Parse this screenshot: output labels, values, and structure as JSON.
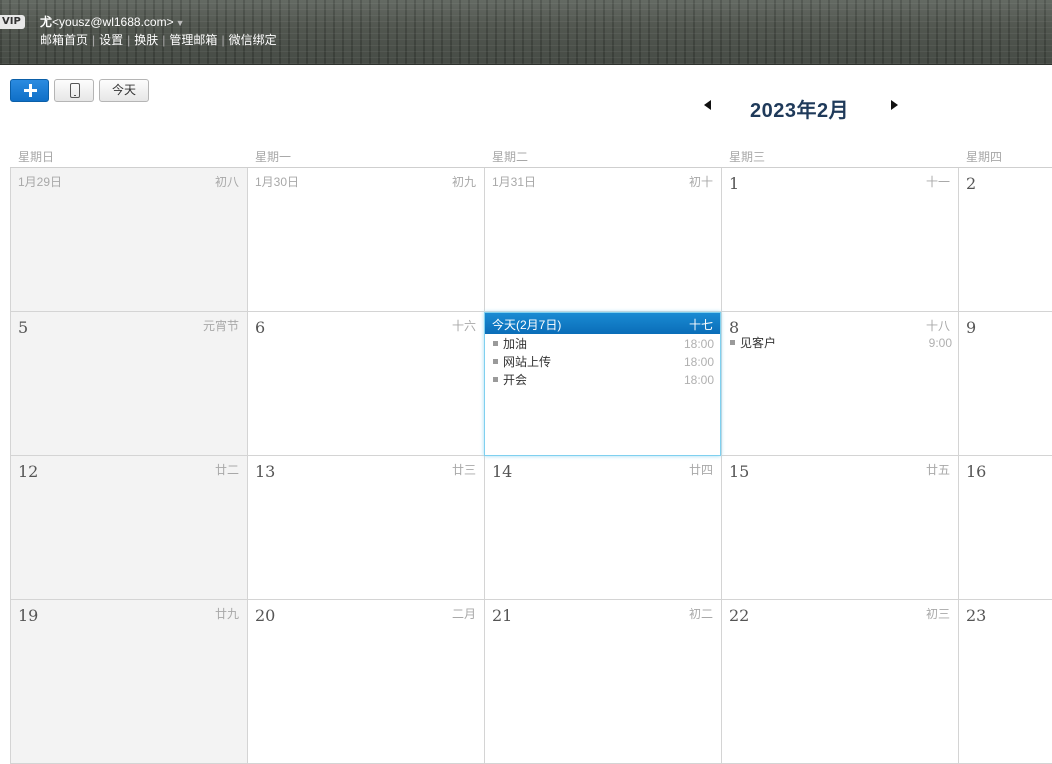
{
  "header": {
    "vip_badge": "VIP",
    "username": "尤",
    "email": "<yousz@wl1688.com>",
    "caret": "▼",
    "links": [
      "邮箱首页",
      "设置",
      "换肤",
      "管理邮箱",
      "微信绑定"
    ],
    "separator": "|"
  },
  "toolbar": {
    "add_icon": "plus-icon",
    "mobile_icon": "mobile-phone-icon",
    "today_label": "今天"
  },
  "month_nav": {
    "title": "2023年2月",
    "prev_icon": "triangle-left-icon",
    "next_icon": "triangle-right-icon"
  },
  "weekdays": [
    "星期日",
    "星期一",
    "星期二",
    "星期三",
    "星期四"
  ],
  "weeks": [
    [
      {
        "day": "1月29日",
        "lunar": "初八",
        "other_month": true
      },
      {
        "day": "1月30日",
        "lunar": "初九",
        "other_month": true
      },
      {
        "day": "1月31日",
        "lunar": "初十",
        "other_month": true
      },
      {
        "day": "1",
        "lunar": "十一"
      },
      {
        "day": "2",
        "lunar": ""
      }
    ],
    [
      {
        "day": "5",
        "lunar": "元宵节"
      },
      {
        "day": "6",
        "lunar": "十六"
      },
      {
        "day": "今天(2月7日)",
        "lunar": "十七",
        "today": true,
        "events": [
          {
            "title": "加油",
            "time": "18:00"
          },
          {
            "title": "网站上传",
            "time": "18:00"
          },
          {
            "title": "开会",
            "time": "18:00"
          }
        ]
      },
      {
        "day": "8",
        "lunar": "十八",
        "events": [
          {
            "title": "见客户",
            "time": "9:00"
          }
        ]
      },
      {
        "day": "9",
        "lunar": ""
      }
    ],
    [
      {
        "day": "12",
        "lunar": "廿二"
      },
      {
        "day": "13",
        "lunar": "廿三"
      },
      {
        "day": "14",
        "lunar": "廿四"
      },
      {
        "day": "15",
        "lunar": "廿五"
      },
      {
        "day": "16",
        "lunar": ""
      }
    ],
    [
      {
        "day": "19",
        "lunar": "廿九"
      },
      {
        "day": "20",
        "lunar": "二月"
      },
      {
        "day": "21",
        "lunar": "初二"
      },
      {
        "day": "22",
        "lunar": "初三"
      },
      {
        "day": "23",
        "lunar": ""
      }
    ]
  ],
  "colors": {
    "accent": "#0f6fc7",
    "today_header": "#0a6db8",
    "title": "#1f3a5a",
    "sunday_bg": "#f3f3f3"
  }
}
